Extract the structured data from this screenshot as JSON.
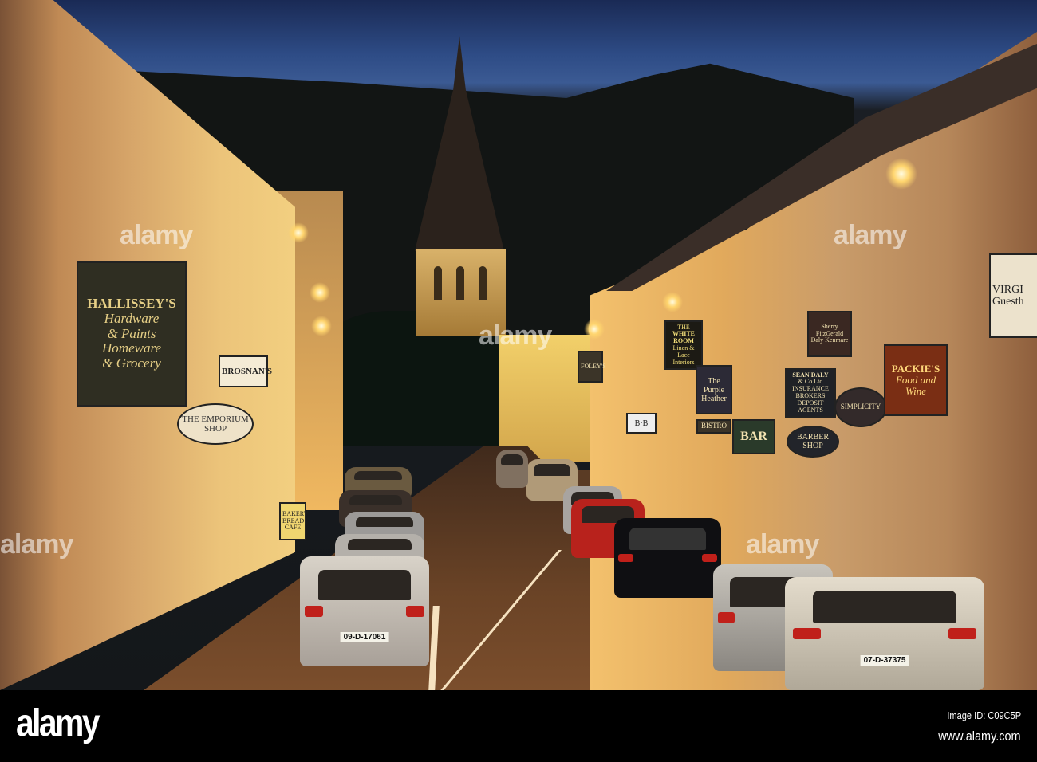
{
  "photo": {
    "signs": {
      "hallisseys": {
        "name": "HALLISSEY'S",
        "line1": "Hardware",
        "line2": "& Paints",
        "line3": "Homeware",
        "line4": "& Grocery"
      },
      "brosnans": "BROSNAN'S",
      "emporium": "THE EMPORIUM SHOP",
      "bakery": {
        "line1": "BAKERY",
        "line2": "BREAD",
        "line3": "CAFE"
      },
      "white_room": {
        "line1": "THE",
        "line2": "WHITE ROOM",
        "line3": "Linen & Lace",
        "line4": "Interiors"
      },
      "foleys": "FOLEY'S",
      "sherry": {
        "line1": "Sherry FitzGerald",
        "line2": "Daly Kenmare"
      },
      "purple_heather": {
        "line1": "The",
        "line2": "Purple",
        "line3": "Heather"
      },
      "bb": "B·B",
      "bistro": "BISTRO",
      "bar": "BAR",
      "sean_daly": {
        "line1": "SEAN DALY",
        "line2": "& Co Ltd",
        "line3": "INSURANCE BROKERS",
        "line4": "DEPOSIT AGENTS"
      },
      "simplicity": "SIMPLICITY",
      "barber": {
        "line1": "BARBER",
        "line2": "SHOP"
      },
      "packies": {
        "line1": "PACKIE'S",
        "line2": "Food and",
        "line3": "Wine"
      },
      "virginia": {
        "line1": "VIRGI",
        "line2": "Guesth"
      }
    },
    "plates": {
      "left_car": "09-D-17061",
      "right_car": "07-D-37375"
    },
    "watermark": "alamy"
  },
  "footer": {
    "logo": "alamy",
    "image_id": "Image ID: C09C5P",
    "site": "www.alamy.com"
  }
}
